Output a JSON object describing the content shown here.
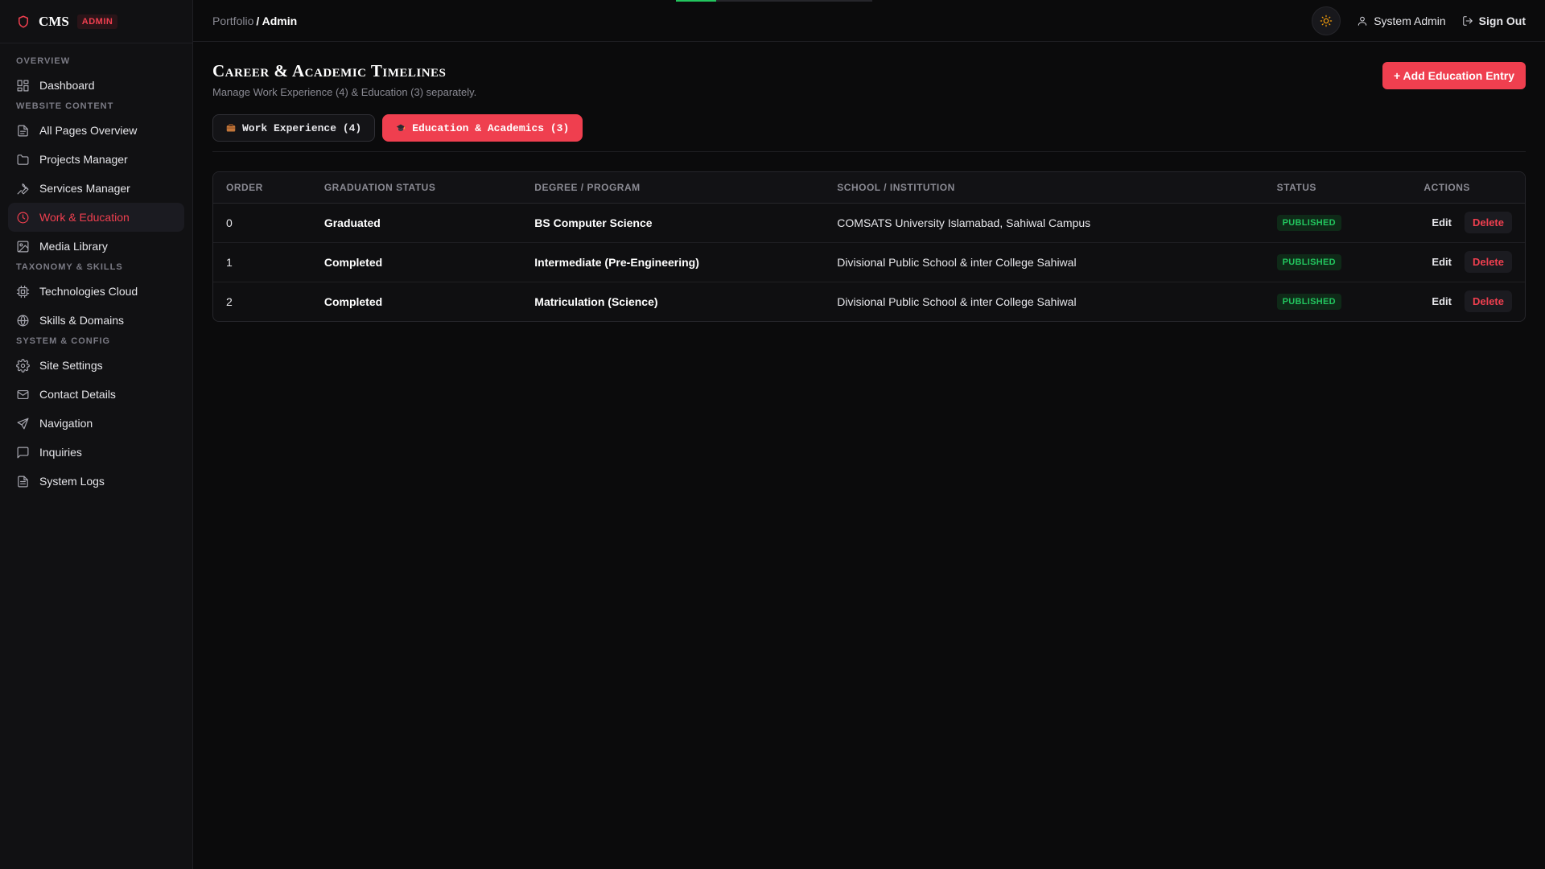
{
  "brand": {
    "name": "CMS",
    "badge": "ADMIN"
  },
  "sidebar": {
    "sections": [
      {
        "title": "OVERVIEW",
        "items": [
          {
            "label": "Dashboard",
            "icon": "dashboard-icon"
          }
        ]
      },
      {
        "title": "WEBSITE CONTENT",
        "items": [
          {
            "label": "All Pages Overview",
            "icon": "file-icon"
          },
          {
            "label": "Projects Manager",
            "icon": "folder-icon"
          },
          {
            "label": "Services Manager",
            "icon": "wrench-icon"
          },
          {
            "label": "Work & Education",
            "icon": "clock-icon",
            "active": true
          },
          {
            "label": "Media Library",
            "icon": "image-icon"
          }
        ]
      },
      {
        "title": "TAXONOMY & SKILLS",
        "items": [
          {
            "label": "Technologies Cloud",
            "icon": "cpu-icon"
          },
          {
            "label": "Skills & Domains",
            "icon": "globe-icon"
          }
        ]
      },
      {
        "title": "SYSTEM & CONFIG",
        "items": [
          {
            "label": "Site Settings",
            "icon": "gear-icon"
          },
          {
            "label": "Contact Details",
            "icon": "mail-icon"
          },
          {
            "label": "Navigation",
            "icon": "send-icon"
          },
          {
            "label": "Inquiries",
            "icon": "message-icon"
          },
          {
            "label": "System Logs",
            "icon": "log-icon"
          }
        ]
      }
    ]
  },
  "topbar": {
    "breadcrumb_parent": "Portfolio",
    "breadcrumb_current": "/ Admin",
    "user_label": "System Admin",
    "signout_label": "Sign Out"
  },
  "page": {
    "title": "Career & Academic Timelines",
    "subtitle": "Manage Work Experience (4) & Education (3) separately.",
    "add_button": "+ Add Education Entry"
  },
  "tabs": [
    {
      "label": "Work Experience (4)",
      "icon": "briefcase-icon",
      "active": false
    },
    {
      "label": "Education & Academics (3)",
      "icon": "graduation-cap-icon",
      "active": true
    }
  ],
  "table": {
    "columns": [
      "ORDER",
      "GRADUATION STATUS",
      "DEGREE / PROGRAM",
      "SCHOOL / INSTITUTION",
      "STATUS",
      "ACTIONS"
    ],
    "rows": [
      {
        "order": "0",
        "graduation": "Graduated",
        "degree": "BS Computer Science",
        "school": "COMSATS University Islamabad, Sahiwal Campus",
        "status": "PUBLISHED"
      },
      {
        "order": "1",
        "graduation": "Completed",
        "degree": "Intermediate (Pre-Engineering)",
        "school": "Divisional Public School & inter College Sahiwal",
        "status": "PUBLISHED"
      },
      {
        "order": "2",
        "graduation": "Completed",
        "degree": "Matriculation (Science)",
        "school": "Divisional Public School & inter College Sahiwal",
        "status": "PUBLISHED"
      }
    ],
    "edit_label": "Edit",
    "delete_label": "Delete"
  },
  "colors": {
    "accent": "#ef3f4f",
    "success": "#22c55e",
    "background": "#0b0b0c",
    "sidebar": "#111113"
  }
}
